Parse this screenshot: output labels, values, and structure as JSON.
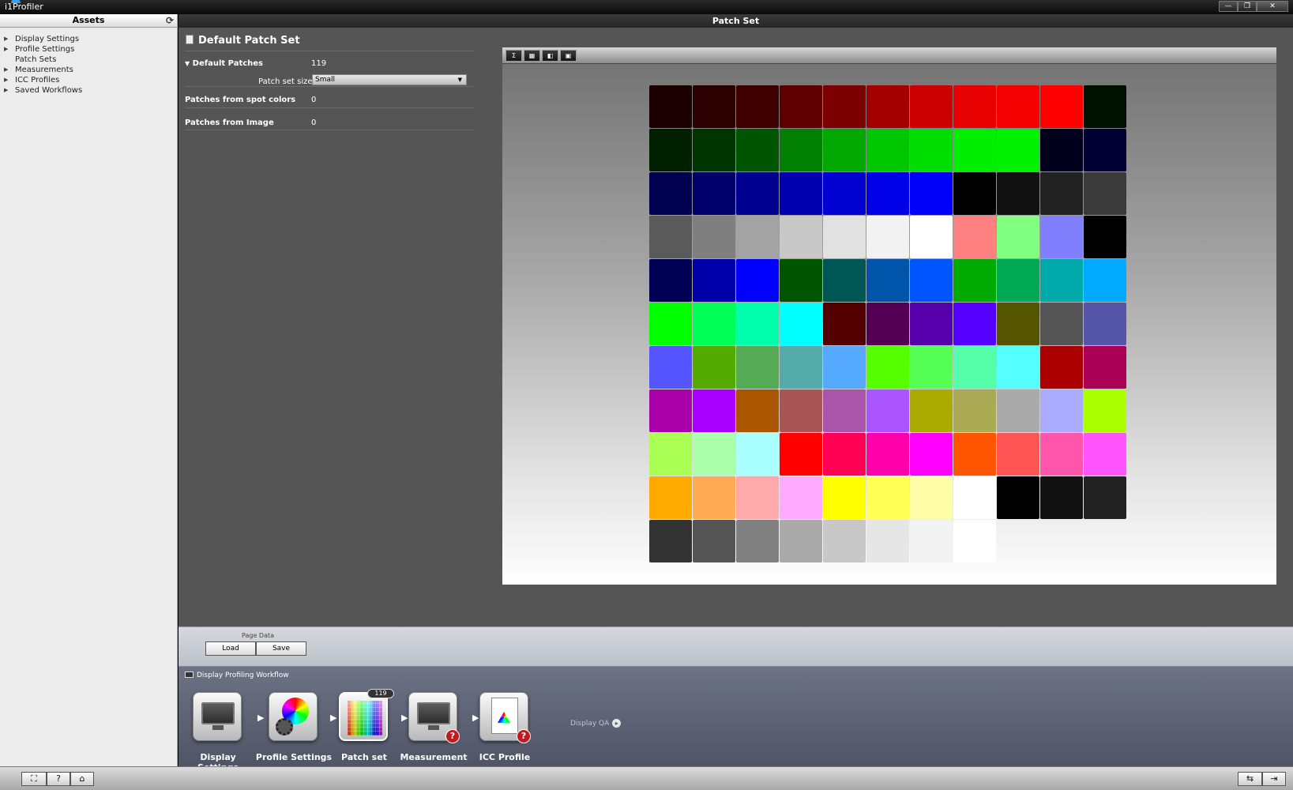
{
  "window": {
    "title": "i1Profiler",
    "controls": [
      "—",
      "❐",
      "✕"
    ]
  },
  "assets": {
    "header": "Assets",
    "items": [
      {
        "label": "Display Settings",
        "expandable": true
      },
      {
        "label": "Profile Settings",
        "expandable": true
      },
      {
        "label": "Patch Sets",
        "expandable": false
      },
      {
        "label": "Measurements",
        "expandable": true
      },
      {
        "label": "ICC Profiles",
        "expandable": true
      },
      {
        "label": "Saved Workflows",
        "expandable": true
      }
    ]
  },
  "main": {
    "header": "Patch Set",
    "title": "Default Patch Set",
    "default_patches": {
      "label": "Default Patches",
      "value": "119"
    },
    "patch_set_size": {
      "label": "Patch set size:",
      "value": "Small"
    },
    "spot_colors": {
      "label": "Patches from spot colors",
      "value": "0"
    },
    "from_image": {
      "label": "Patches from Image",
      "value": "0"
    }
  },
  "preview": {
    "toolbar": [
      "Σ",
      "▦",
      "◧",
      "▣"
    ],
    "columns": 11,
    "patches": [
      "#1b0000",
      "#2a0000",
      "#3f0000",
      "#5e0000",
      "#7d0000",
      "#a40000",
      "#cc0000",
      "#e60000",
      "#f50000",
      "#ff0000",
      "#001100",
      "#002000",
      "#003500",
      "#005500",
      "#007f00",
      "#00a800",
      "#00c600",
      "#00dd00",
      "#00ee00",
      "#00f200",
      "#00001c",
      "#000032",
      "#000050",
      "#00006c",
      "#000090",
      "#0000b0",
      "#0000d0",
      "#0000e6",
      "#0000f8",
      "#000000",
      "#121212",
      "#222222",
      "#3a3a3a",
      "#5a5a5a",
      "#7f7f7f",
      "#a3a3a3",
      "#c8c8c8",
      "#e1e1e1",
      "#f2f2f2",
      "#ffffff",
      "#ff8080",
      "#80ff80",
      "#8080ff",
      "#000000",
      "#000055",
      "#0000aa",
      "#0000ff",
      "#005500",
      "#005555",
      "#0055aa",
      "#0055ff",
      "#00aa00",
      "#00aa55",
      "#00aaaa",
      "#00aaff",
      "#00ff00",
      "#00ff55",
      "#00ffaa",
      "#00ffff",
      "#550000",
      "#550055",
      "#5500aa",
      "#5500ff",
      "#555500",
      "#555555",
      "#5555aa",
      "#5555ff",
      "#55aa00",
      "#55aa55",
      "#55aaaa",
      "#55aaff",
      "#55ff00",
      "#55ff55",
      "#55ffaa",
      "#55ffff",
      "#aa0000",
      "#aa0055",
      "#aa00aa",
      "#aa00ff",
      "#aa5500",
      "#aa5555",
      "#aa55aa",
      "#aa55ff",
      "#aaaa00",
      "#aaaa55",
      "#aaaaaa",
      "#aaaaff",
      "#aaff00",
      "#aaff55",
      "#aaffaa",
      "#aaffff",
      "#ff0000",
      "#ff0055",
      "#ff00aa",
      "#ff00ff",
      "#ff5500",
      "#ff5555",
      "#ff55aa",
      "#ff55ff",
      "#ffaa00",
      "#ffaa55",
      "#ffaaaa",
      "#ffaaff",
      "#ffff00",
      "#ffff55",
      "#ffffaa",
      "#ffffff",
      "#000000",
      "#111111",
      "#222222",
      "#333333",
      "#555555",
      "#808080",
      "#aaaaaa",
      "#c8c8c8",
      "#e6e6e6",
      "#f3f3f3",
      "#ffffff"
    ]
  },
  "page_data": {
    "label": "Page Data",
    "load": "Load",
    "save": "Save"
  },
  "workflow": {
    "title": "Display Profiling Workflow",
    "steps": [
      {
        "label": "Display Settings",
        "icon": "display-settings-icon"
      },
      {
        "label": "Profile Settings",
        "icon": "profile-settings-icon"
      },
      {
        "label": "Patch set",
        "icon": "patch-set-icon",
        "badge": "119"
      },
      {
        "label": "Measurement",
        "icon": "measurement-icon",
        "warning": "?"
      },
      {
        "label": "ICC Profile",
        "icon": "icc-profile-icon",
        "warning": "?"
      }
    ],
    "display_qa": "Display QA"
  },
  "statusbar": {
    "left": [
      "⛶",
      "?",
      "⌂"
    ],
    "right": [
      "⇆",
      "⇥"
    ]
  },
  "colors": {
    "accent_warning": "#c2191f"
  }
}
